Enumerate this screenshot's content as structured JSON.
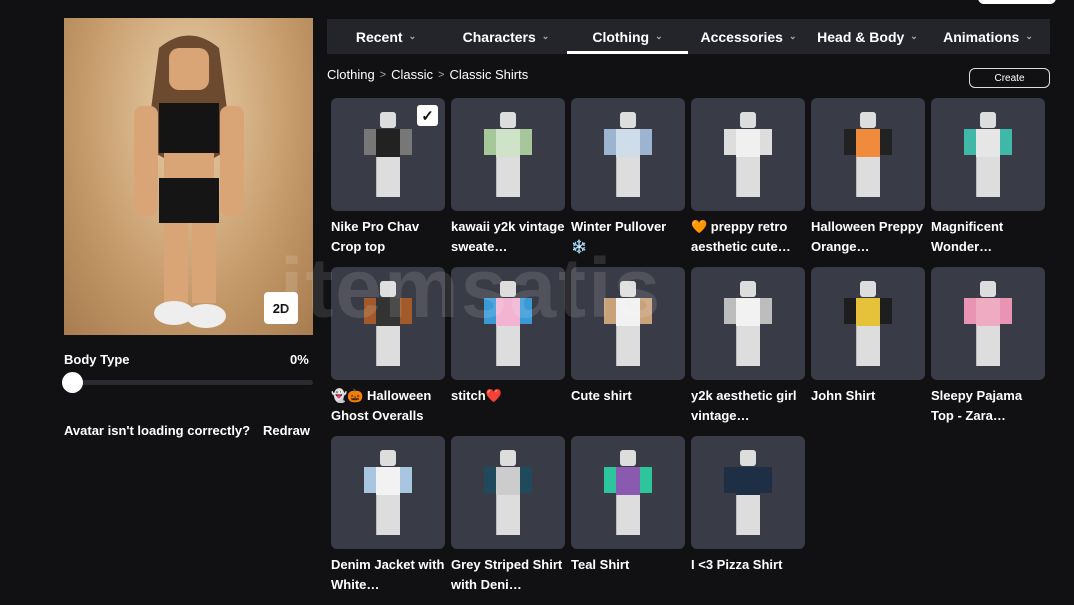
{
  "avatar": {
    "view_toggle": "2D"
  },
  "body_type": {
    "label": "Body Type",
    "value": "0%",
    "fraction": 0
  },
  "loading": {
    "message": "Avatar isn't loading correctly?",
    "action": "Redraw"
  },
  "tabs": [
    {
      "label": "Recent"
    },
    {
      "label": "Characters"
    },
    {
      "label": "Clothing",
      "active": true
    },
    {
      "label": "Accessories"
    },
    {
      "label": "Head & Body"
    },
    {
      "label": "Animations"
    }
  ],
  "breadcrumb": [
    "Clothing",
    "Classic",
    "Classic Shirts"
  ],
  "create_label": "Create",
  "watermark": "itemsatis",
  "items": [
    {
      "title": "Nike Pro Chav Crop top",
      "color": "#222222",
      "arm": "#777777",
      "selected": true
    },
    {
      "title": "kawaii y2k vintage sweate…",
      "color": "#cfe3c8",
      "arm": "#a6c79a"
    },
    {
      "title": "Winter Pullover ❄️",
      "color": "#cfdcea",
      "arm": "#9db4d1"
    },
    {
      "title": "🧡 preppy retro aesthetic cute…",
      "color": "#f0f0f0",
      "arm": "#dddddd"
    },
    {
      "title": "Halloween Preppy Orange…",
      "color": "#f08a3c",
      "arm": "#222222"
    },
    {
      "title": "Magnificent Wonder…",
      "color": "#e6e6e6",
      "arm": "#40b8a8"
    },
    {
      "title": "👻🎃 Halloween Ghost Overalls",
      "color": "#333333",
      "arm": "#a35a2a"
    },
    {
      "title": "stitch❤️",
      "color": "#f2b4d2",
      "arm": "#3a9ad6"
    },
    {
      "title": "Cute shirt",
      "color": "#f2f2f2",
      "arm": "#c9a27a"
    },
    {
      "title": "y2k aesthetic girl vintage…",
      "color": "#f2f2f2",
      "arm": "#bdbdbd"
    },
    {
      "title": "John Shirt",
      "color": "#e6c23a",
      "arm": "#1e1e1e"
    },
    {
      "title": "Sleepy Pajama Top - Zara…",
      "color": "#eeabc2",
      "arm": "#e994b3"
    },
    {
      "title": "Denim Jacket with White…",
      "color": "#f2f2f2",
      "arm": "#a9c6e0"
    },
    {
      "title": "Grey Striped Shirt with Deni…",
      "color": "#cccccc",
      "arm": "#1f4a5c"
    },
    {
      "title": "Teal Shirt",
      "color": "#8a5ab0",
      "arm": "#2ec49c"
    },
    {
      "title": "I <3 Pizza Shirt",
      "color": "#1e2e44",
      "arm": "#1e2e44"
    }
  ]
}
